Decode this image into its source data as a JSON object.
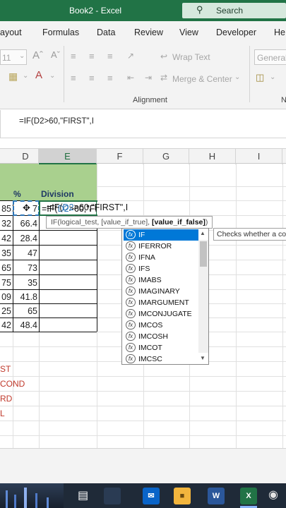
{
  "titlebar": {
    "title": "Book2  -  Excel",
    "search_label": "Search"
  },
  "menu": [
    "ayout",
    "Formulas",
    "Data",
    "Review",
    "View",
    "Developer",
    "He"
  ],
  "ribbon": {
    "font_size": "11",
    "wrap_text": "Wrap Text",
    "merge_center": "Merge & Center",
    "number_format": "General",
    "group_alignment": "Alignment",
    "group_cut": "N"
  },
  "formula_bar": {
    "text": "=IF(D2>60,\"FIRST\",I"
  },
  "columns": [
    "D",
    "E",
    "F",
    "G",
    "H",
    "I"
  ],
  "headers": {
    "pct": "%",
    "division": "Division"
  },
  "rows": [
    {
      "left": "85",
      "pct": "7"
    },
    {
      "left": "32",
      "pct": "66.4"
    },
    {
      "left": "42",
      "pct": "28.4"
    },
    {
      "left": "35",
      "pct": "47"
    },
    {
      "left": "65",
      "pct": "73"
    },
    {
      "left": "75",
      "pct": "35"
    },
    {
      "left": "09",
      "pct": "41.8"
    },
    {
      "left": "25",
      "pct": "65"
    },
    {
      "left": "42",
      "pct": "48.4"
    }
  ],
  "edit_cell": {
    "prefix": "=IF(",
    "ref": "D2",
    "suffix": ">60,\"FIRST\",I"
  },
  "tooltip": {
    "text": "IF(logical_test, [value_if_true], ",
    "bold": "[value_if_false]",
    "close": ")"
  },
  "autocomplete": {
    "fx_label": "fx",
    "items": [
      "IF",
      "IFERROR",
      "IFNA",
      "IFS",
      "IMABS",
      "IMAGINARY",
      "IMARGUMENT",
      "IMCONJUGATE",
      "IMCOS",
      "IMCOSH",
      "IMCOT",
      "IMCSC"
    ],
    "selected_index": 0,
    "description": "Checks whether a co"
  },
  "side_labels": [
    "ST",
    "COND",
    "RD",
    "L"
  ],
  "taskbar": {
    "word_label": "W",
    "excel_label": "X",
    "colors": {
      "word": "#2b579a",
      "excel": "#217346",
      "mail": "#0a64c8",
      "folder": "#f2b53d",
      "store": "#3a7bd5"
    }
  }
}
